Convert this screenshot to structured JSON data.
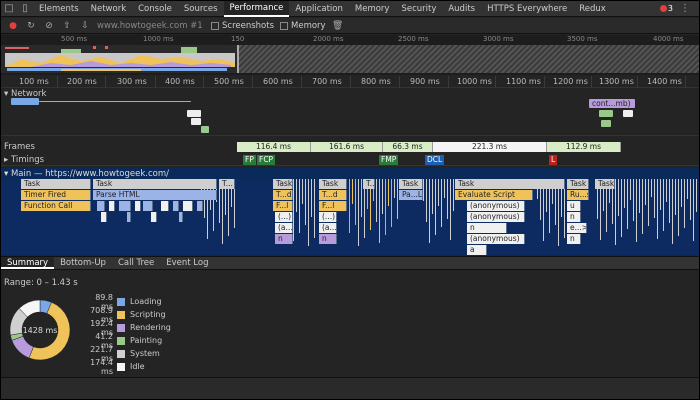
{
  "tabs": [
    {
      "label": "Elements",
      "active": false
    },
    {
      "label": "Network",
      "active": false
    },
    {
      "label": "Console",
      "active": false
    },
    {
      "label": "Sources",
      "active": false
    },
    {
      "label": "Performance",
      "active": true
    },
    {
      "label": "Application",
      "active": false
    },
    {
      "label": "Memory",
      "active": false
    },
    {
      "label": "Security",
      "active": false
    },
    {
      "label": "Audits",
      "active": false
    },
    {
      "label": "HTTPS Everywhere",
      "active": false
    },
    {
      "label": "Redux",
      "active": false
    }
  ],
  "error_count": "3",
  "toolbar": {
    "profile": "www.howtogeek.com #1",
    "screenshots_label": "Screenshots",
    "memory_label": "Memory"
  },
  "overview_ticks": [
    "500 ms",
    "1000 ms",
    "150",
    "2000 ms",
    "2500 ms",
    "3000 ms",
    "3500 ms",
    "4000 ms"
  ],
  "ruler_ticks": [
    "100 ms",
    "200 ms",
    "300 ms",
    "400 ms",
    "500 ms",
    "600 ms",
    "700 ms",
    "800 ms",
    "900 ms",
    "1000 ms",
    "1100 ms",
    "1200 ms",
    "1300 ms",
    "1400 ms"
  ],
  "network": {
    "label": "Network",
    "request_label": "cont...mb)"
  },
  "frames": {
    "label": "Frames",
    "boxes": [
      "116.4 ms",
      "161.6 ms",
      "66.3 ms",
      "221.3 ms",
      "112.9 ms"
    ]
  },
  "timings": {
    "label": "Timings",
    "marks": [
      {
        "label": "FP",
        "color": "#2a7a3a"
      },
      {
        "label": "FCP",
        "color": "#2a7a3a"
      },
      {
        "label": "FMP",
        "color": "#2a7a3a"
      },
      {
        "label": "DCL",
        "color": "#1a5fb4"
      },
      {
        "label": "L",
        "color": "#c0201a"
      }
    ]
  },
  "main": {
    "label": "Main — https://www.howtogeek.com/",
    "tasks": [
      "Task",
      "Task",
      "T...",
      "Task",
      "Task",
      "T...",
      "Task",
      "Task",
      "Task",
      "Task"
    ],
    "row2": [
      "Timer Fired",
      "Parse HTML",
      "T...d",
      "T...d",
      "Pa...L",
      "Evaluate Script",
      "Ru...s"
    ],
    "row3": [
      "Function Call",
      "F...l",
      "F...l",
      "(anonymous)",
      "u"
    ],
    "row4": [
      "(...)",
      "(...)",
      "(anonymous)",
      "n"
    ],
    "row5": [
      "(a...)",
      "(a...)",
      "n",
      "e...>"
    ],
    "row6": [
      "n",
      "n",
      "(anonymous)",
      "n"
    ],
    "row7": [
      "a"
    ]
  },
  "bottom_tabs": [
    {
      "label": "Summary",
      "active": true
    },
    {
      "label": "Bottom-Up",
      "active": false
    },
    {
      "label": "Call Tree",
      "active": false
    },
    {
      "label": "Event Log",
      "active": false
    }
  ],
  "summary": {
    "range": "Range: 0 – 1.43 s",
    "total": "1428 ms",
    "items": [
      {
        "value": "89.8 ms",
        "name": "Loading",
        "color": "#7aa8e6"
      },
      {
        "value": "708.9 ms",
        "name": "Scripting",
        "color": "#f0c35a"
      },
      {
        "value": "192.4 ms",
        "name": "Rendering",
        "color": "#b79bdb"
      },
      {
        "value": "41.2 ms",
        "name": "Painting",
        "color": "#9ac889"
      },
      {
        "value": "221.7 ms",
        "name": "System",
        "color": "#d0d0d0"
      },
      {
        "value": "174.4 ms",
        "name": "Idle",
        "color": "#f6f6f6"
      }
    ]
  }
}
